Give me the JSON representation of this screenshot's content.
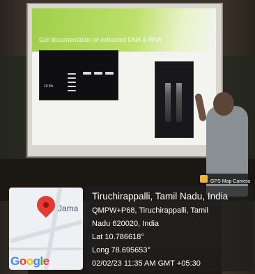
{
  "slide": {
    "title": "Gel documentation of extracted DNA & RNA",
    "gel_label": "10 Kb"
  },
  "camera_badge": {
    "label": "GPS Map Camera"
  },
  "map": {
    "place_label": "Jama",
    "brand": "Google",
    "brand_colors": [
      "#4285F4",
      "#EA4335",
      "#FBBC05",
      "#4285F4",
      "#34A853",
      "#EA4335"
    ]
  },
  "location": {
    "title": "Tiruchirappalli, Tamil Nadu, India",
    "address_line1": "QMPW+P68, Tiruchirappalli, Tamil",
    "address_line2": "Nadu 620020, India",
    "lat": "Lat 10.786618°",
    "long": "Long 78.695653°",
    "timestamp": "02/02/23 11:35 AM GMT +05:30"
  }
}
